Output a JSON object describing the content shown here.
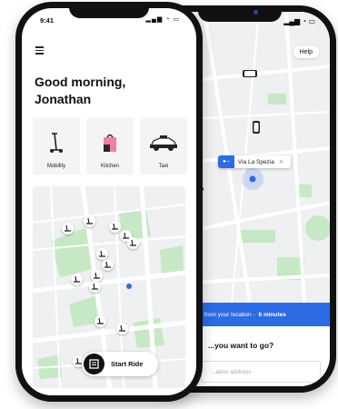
{
  "front": {
    "status_time": "9:41",
    "greeting": "Good morning,\nJonathan",
    "services": [
      {
        "label": "Mobility",
        "icon": "scooter-icon"
      },
      {
        "label": "Kitchen",
        "icon": "food-bag-icon"
      },
      {
        "label": "Taxi",
        "icon": "car-icon"
      }
    ],
    "start_ride_label": "Start Ride"
  },
  "back": {
    "help_label": "Help",
    "destination_chip": "Via La Spezia",
    "eta_text": "...ble from your location -",
    "eta_time": "6 minutes",
    "question": "...you want to go?",
    "input_placeholder": "...ation address"
  },
  "colors": {
    "accent": "#2d6be4",
    "map_bg": "#eef0f2",
    "park_green": "#c7e8c5"
  }
}
